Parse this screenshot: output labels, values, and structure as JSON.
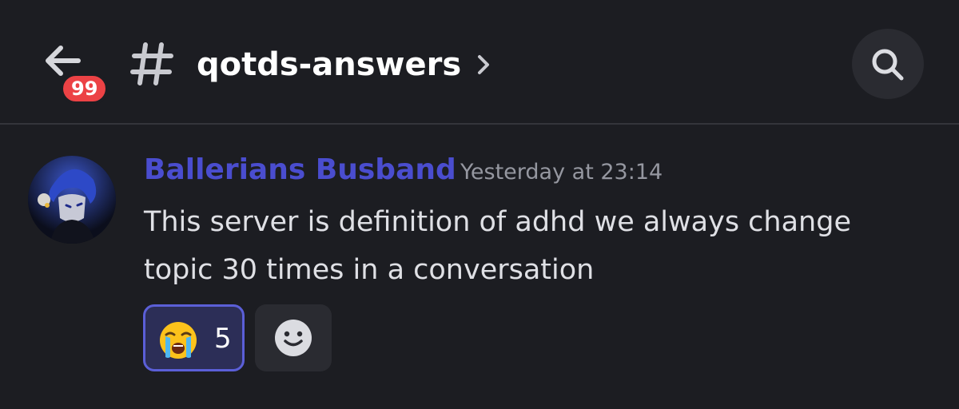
{
  "header": {
    "unread_badge": "99",
    "channel_name": "qotds-answers",
    "back_icon": "arrow-left-icon",
    "channel_icon": "hash-icon",
    "chevron_icon": "chevron-right-icon",
    "search_icon": "search-icon"
  },
  "message": {
    "author": "Ballerians Busband",
    "timestamp": "Yesterday at 23:14",
    "text": "This server is definition of adhd we always change topic 30 times in a conversation",
    "author_color": "#4a4dcf"
  },
  "reactions": [
    {
      "emoji": "😭",
      "emoji_name": "loudly-crying-face",
      "count": "5",
      "selected": true
    }
  ],
  "add_reaction_icon": "smiley-face-icon",
  "colors": {
    "background": "#1c1d22",
    "badge": "#ec4245",
    "reaction_border": "#5b5fd8",
    "reaction_bg": "#2c2e57"
  }
}
